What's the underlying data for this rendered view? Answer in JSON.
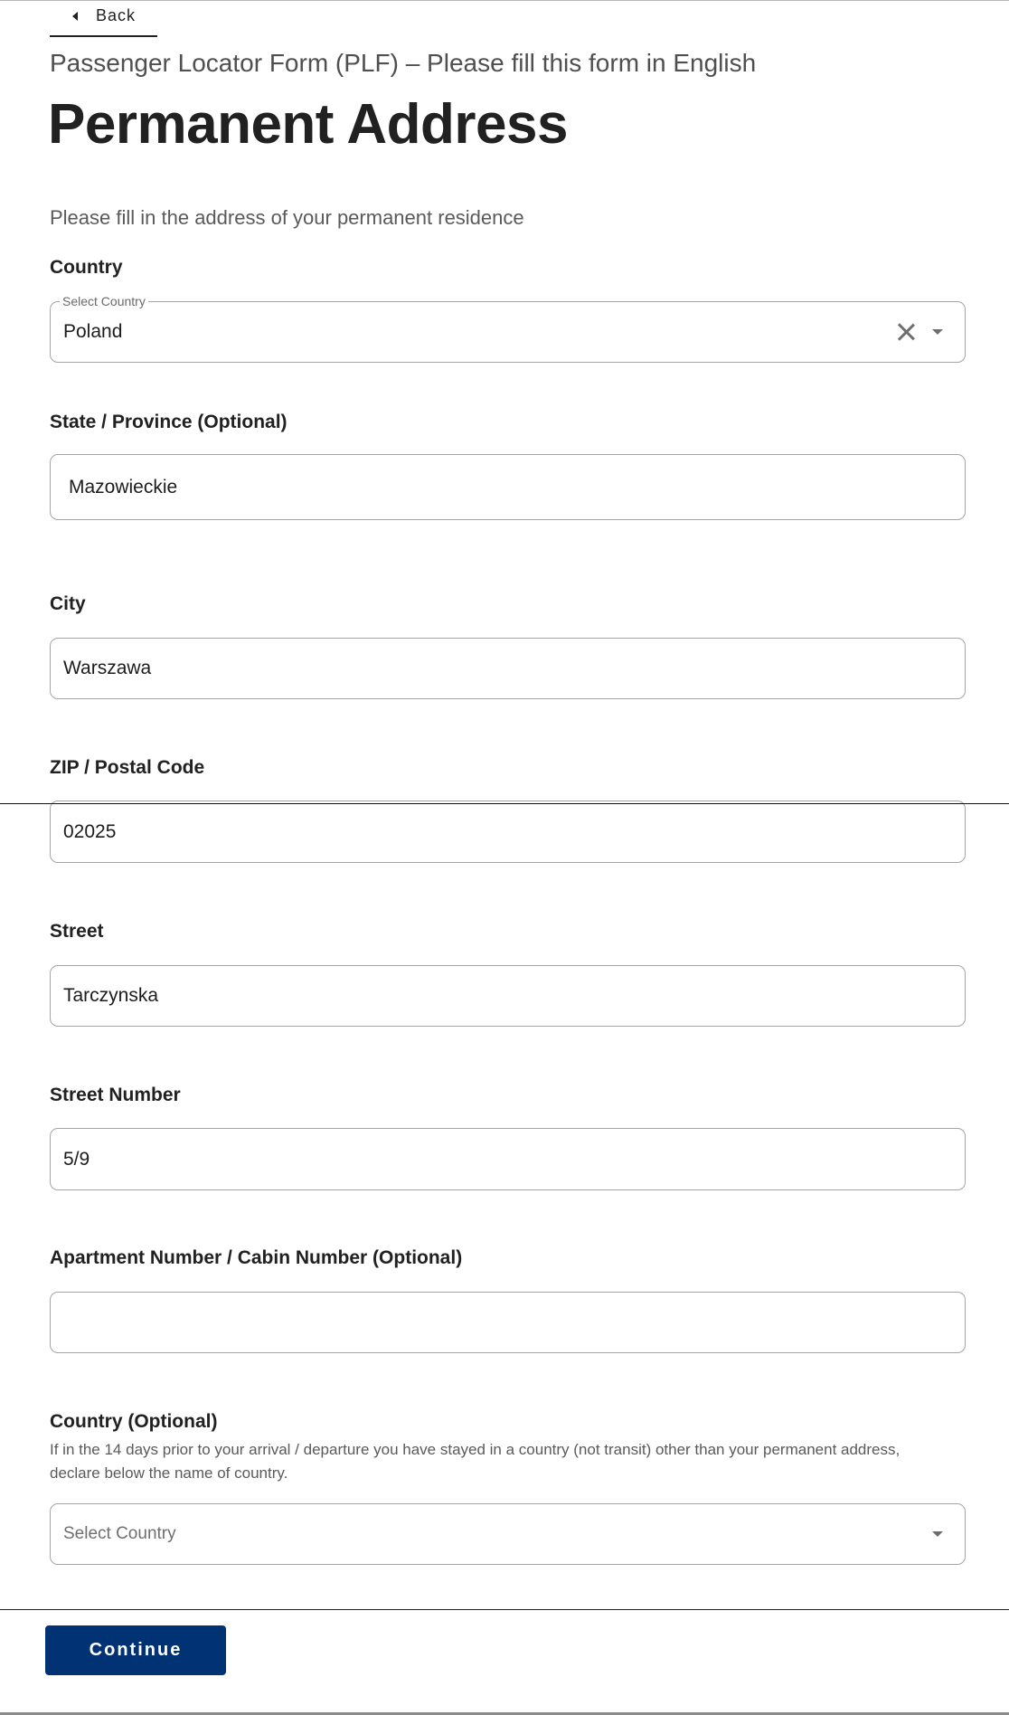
{
  "nav": {
    "back_label": "Back"
  },
  "header": {
    "subtitle": "Passenger Locator Form (PLF) – Please fill this form in English",
    "title": "Permanent Address",
    "description": "Please fill in the address of your permanent residence"
  },
  "fields": {
    "country": {
      "label": "Country",
      "legend": "Select Country",
      "value": "Poland"
    },
    "state": {
      "label": "State / Province (Optional)",
      "value": "Mazowieckie"
    },
    "city": {
      "label": "City",
      "value": "Warszawa"
    },
    "zip": {
      "label": "ZIP / Postal Code",
      "value": "02025"
    },
    "street": {
      "label": "Street",
      "value": "Tarczynska"
    },
    "street_number": {
      "label": "Street Number",
      "value": "5/9"
    },
    "apartment": {
      "label": "Apartment Number / Cabin Number (Optional)",
      "value": ""
    },
    "other_country": {
      "label": "Country (Optional)",
      "help_line1": "If in the 14 days prior to your arrival / departure you have stayed in a country (not transit) other than your permanent address,",
      "help_line2": "declare below the name of country.",
      "placeholder": "Select Country"
    }
  },
  "footer": {
    "continue_label": "Continue",
    "button_color": "#003274"
  }
}
